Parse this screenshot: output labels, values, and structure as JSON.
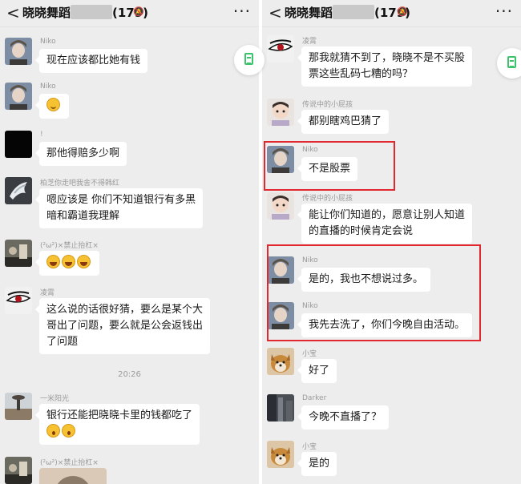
{
  "left": {
    "header": {
      "back": "<",
      "title_start": "晓晓舞蹈",
      "title_count": "(179)",
      "more": "···"
    },
    "messages": [
      {
        "sender": "Niko",
        "text": "现在应该都比她有钱"
      },
      {
        "sender": "Niko",
        "text": ""
      },
      {
        "sender": "!",
        "text": "那他得赔多少啊"
      },
      {
        "sender": "柏芝你走吧我舍不得韩红",
        "lines": [
          "嗯应该是  你们不知道银行有多黑",
          "暗和霸道我理解"
        ]
      },
      {
        "sender": "(²ω²)×禁止抬杠×",
        "text": ""
      },
      {
        "sender": "凌霄",
        "lines": [
          "这么说的话很好猜，要么是某个大",
          "哥出了问题，要么就是公会返钱出",
          "了问题"
        ]
      },
      {
        "sender": "一米阳光",
        "lines": [
          "银行还能把晓晓卡里的钱都吃了",
          ""
        ]
      },
      {
        "sender": "(²ω²)×禁止抬杠×",
        "text": ""
      }
    ],
    "timestamp": "20:26"
  },
  "right": {
    "header": {
      "back": "<",
      "title_start": "晓晓舞蹈",
      "title_count": "(179)",
      "more": "···"
    },
    "messages": [
      {
        "sender": "凌霄",
        "lines": [
          "那我就猜不到了，晓晓不是不买股",
          "票这些乱码七糟的吗？"
        ]
      },
      {
        "sender": "传说中的小屁孩",
        "text": "都别瞎鸡巴猜了"
      },
      {
        "sender": "Niko",
        "text": "不是股票"
      },
      {
        "sender": "传说中的小屁孩",
        "lines": [
          "能让你们知道的，愿意让别人知道",
          "的直播的时候肯定会说"
        ]
      },
      {
        "sender": "Niko",
        "text": "是的，我也不想说过多。"
      },
      {
        "sender": "Niko",
        "text": "我先去洗了，你们今晚自由活动。"
      },
      {
        "sender": "小宝",
        "text": "好了"
      },
      {
        "sender": "Darker",
        "text": "今晚不直播了？"
      },
      {
        "sender": "小宝",
        "text": "是的"
      }
    ]
  },
  "colors": {
    "highlight": "#e0282e",
    "background": "#ededed",
    "bubble": "#ffffff",
    "accent": "#3cc46a"
  },
  "icons": [
    "back-icon",
    "mute-bell-icon",
    "more-icon",
    "document-icon",
    "smile-emoji-icon",
    "laugh-cry-emoji-icon",
    "shocked-emoji-icon"
  ]
}
